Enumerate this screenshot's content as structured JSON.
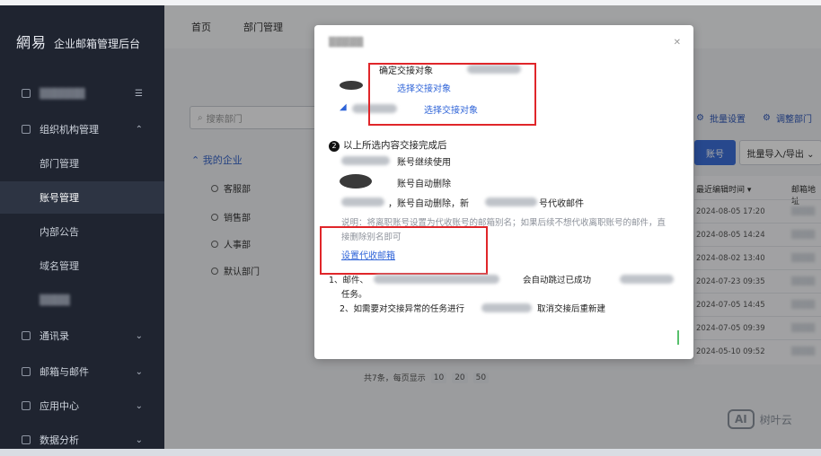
{
  "brand": {
    "logo": "網易",
    "title": "企业邮箱管理后台"
  },
  "sidebar": {
    "items": [
      {
        "label": "组织机构管理"
      },
      {
        "label": "部门管理"
      },
      {
        "label": "账号管理"
      },
      {
        "label": "内部公告"
      },
      {
        "label": "域名管理"
      },
      {
        "label": "通讯录"
      },
      {
        "label": "邮箱与邮件"
      },
      {
        "label": "应用中心"
      },
      {
        "label": "数据分析"
      }
    ]
  },
  "tabs": {
    "home": "首页",
    "dept": "部门管理"
  },
  "dept_search_placeholder": "搜索部门",
  "tree": {
    "root": "我的企业",
    "items": [
      "客服部",
      "销售部",
      "人事部",
      "默认部门"
    ]
  },
  "actions": {
    "batch_settings": "批量设置",
    "adjust_dept": "调整部门",
    "add_account_suffix": "账号",
    "batch_import": "批量导入/导出 ⌄"
  },
  "table": {
    "col_recent": "最近编辑时间 ▾",
    "col_mail": "邮箱地址",
    "rows": [
      {
        "time": "2024-08-05 17:20"
      },
      {
        "time": "2024-08-05 14:24"
      },
      {
        "time": "2024-08-02 13:40"
      },
      {
        "time": "2024-07-23 09:35"
      },
      {
        "time": "2024-07-05 14:45"
      },
      {
        "time": "2024-07-05 09:39"
      },
      {
        "time": "2024-05-10 09:52"
      }
    ]
  },
  "pager": {
    "text": "共7条，每页显示",
    "sizes": [
      "10",
      "20",
      "50"
    ]
  },
  "modal": {
    "confirm_target": "确定交接对象",
    "choose_target_1": "选择交接对象",
    "choose_target_2": "选择交接对象",
    "section_title": "以上所选内容交接完成后",
    "section_number": "2",
    "opt_keep": "账号继续使用",
    "opt_delete": "账号自动删除",
    "auto_delete_note": "，账号自动删除，新",
    "auto_delete_note2": "号代收邮件",
    "explain_1": "说明：将离职账号设置为代收账号的邮箱别名；如果后续不想代收离职账号的邮件，直",
    "explain_2": "接删除别名即可",
    "set_mailbox_link": "设置代收邮箱",
    "note_1a": "1、邮件、",
    "note_1b": "会自动跳过已成功",
    "note_1c": "任务。",
    "note_2a": "2、如需要对交接异常的任务进行",
    "note_2b": "取消交接后重新建"
  },
  "watermark": {
    "badge": "AI",
    "name": "树叶云"
  }
}
